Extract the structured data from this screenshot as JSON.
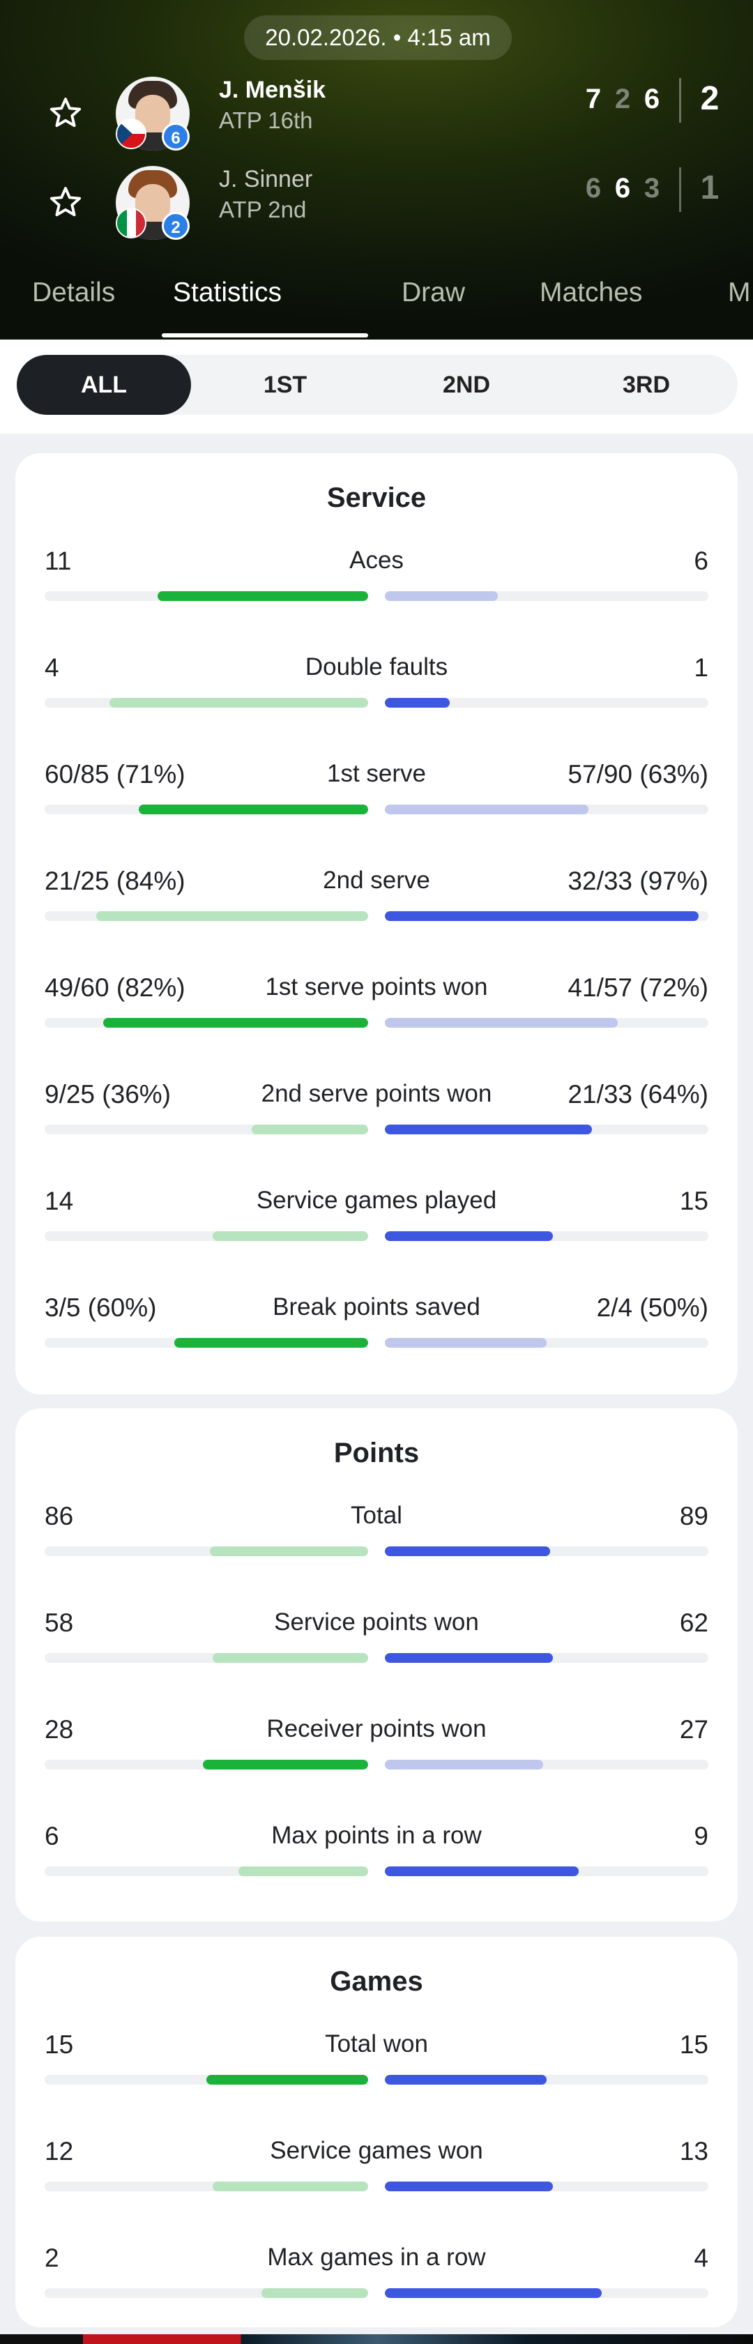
{
  "match": {
    "datetime": "20.02.2026. • 4:15 am",
    "players": [
      {
        "name": "J. Menšik",
        "rank": "ATP 16th",
        "seed": "6",
        "sets": [
          "7",
          "2",
          "6"
        ],
        "set_highlight": [
          true,
          false,
          true
        ],
        "total": "2",
        "total_winner": true,
        "flag": "czech-flag-icon",
        "hair_color": "#3a2c22"
      },
      {
        "name": "J. Sinner",
        "rank": "ATP 2nd",
        "seed": "2",
        "sets": [
          "6",
          "6",
          "3"
        ],
        "set_highlight": [
          false,
          true,
          false
        ],
        "total": "1",
        "total_winner": false,
        "flag": "italy-flag-icon",
        "hair_color": "#8a4a22"
      }
    ]
  },
  "tabs": [
    "Details",
    "Statistics",
    "Draw",
    "Matches",
    "M"
  ],
  "active_tab": "Statistics",
  "periods": [
    "ALL",
    "1ST",
    "2ND",
    "3RD"
  ],
  "active_period": "ALL",
  "colors": {
    "green_strong": "#1bb23a",
    "green_light": "#b7e3bf",
    "blue_strong": "#3d57e0",
    "blue_light": "#bfc7ec",
    "track": "#eff0f2",
    "dim_score": "#7d8478"
  },
  "sections": [
    {
      "title": "Service",
      "stats": [
        {
          "label": "Aces",
          "left": "11",
          "right": "6",
          "left_frac": 0.65,
          "right_frac": 0.35,
          "winner": "left"
        },
        {
          "label": "Double faults",
          "left": "4",
          "right": "1",
          "left_frac": 0.8,
          "right_frac": 0.2,
          "winner": "right"
        },
        {
          "label": "1st serve",
          "left": "60/85 (71%)",
          "right": "57/90 (63%)",
          "left_frac": 0.71,
          "right_frac": 0.63,
          "winner": "left"
        },
        {
          "label": "2nd serve",
          "left": "21/25 (84%)",
          "right": "32/33 (97%)",
          "left_frac": 0.84,
          "right_frac": 0.97,
          "winner": "right"
        },
        {
          "label": "1st serve points won",
          "left": "49/60 (82%)",
          "right": "41/57 (72%)",
          "left_frac": 0.82,
          "right_frac": 0.72,
          "winner": "left"
        },
        {
          "label": "2nd serve points won",
          "left": "9/25 (36%)",
          "right": "21/33 (64%)",
          "left_frac": 0.36,
          "right_frac": 0.64,
          "winner": "right"
        },
        {
          "label": "Service games played",
          "left": "14",
          "right": "15",
          "left_frac": 0.48,
          "right_frac": 0.52,
          "winner": "right"
        },
        {
          "label": "Break points saved",
          "left": "3/5 (60%)",
          "right": "2/4 (50%)",
          "left_frac": 0.6,
          "right_frac": 0.5,
          "winner": "left"
        }
      ]
    },
    {
      "title": "Points",
      "stats": [
        {
          "label": "Total",
          "left": "86",
          "right": "89",
          "left_frac": 0.49,
          "right_frac": 0.51,
          "winner": "right"
        },
        {
          "label": "Service points won",
          "left": "58",
          "right": "62",
          "left_frac": 0.48,
          "right_frac": 0.52,
          "winner": "right"
        },
        {
          "label": "Receiver points won",
          "left": "28",
          "right": "27",
          "left_frac": 0.51,
          "right_frac": 0.49,
          "winner": "left"
        },
        {
          "label": "Max points in a row",
          "left": "6",
          "right": "9",
          "left_frac": 0.4,
          "right_frac": 0.6,
          "winner": "right"
        }
      ]
    },
    {
      "title": "Games",
      "stats": [
        {
          "label": "Total won",
          "left": "15",
          "right": "15",
          "left_frac": 0.5,
          "right_frac": 0.5,
          "winner": "both"
        },
        {
          "label": "Service games won",
          "left": "12",
          "right": "13",
          "left_frac": 0.48,
          "right_frac": 0.52,
          "winner": "right"
        },
        {
          "label": "Max games in a row",
          "left": "2",
          "right": "4",
          "left_frac": 0.33,
          "right_frac": 0.67,
          "winner": "right"
        }
      ]
    }
  ]
}
